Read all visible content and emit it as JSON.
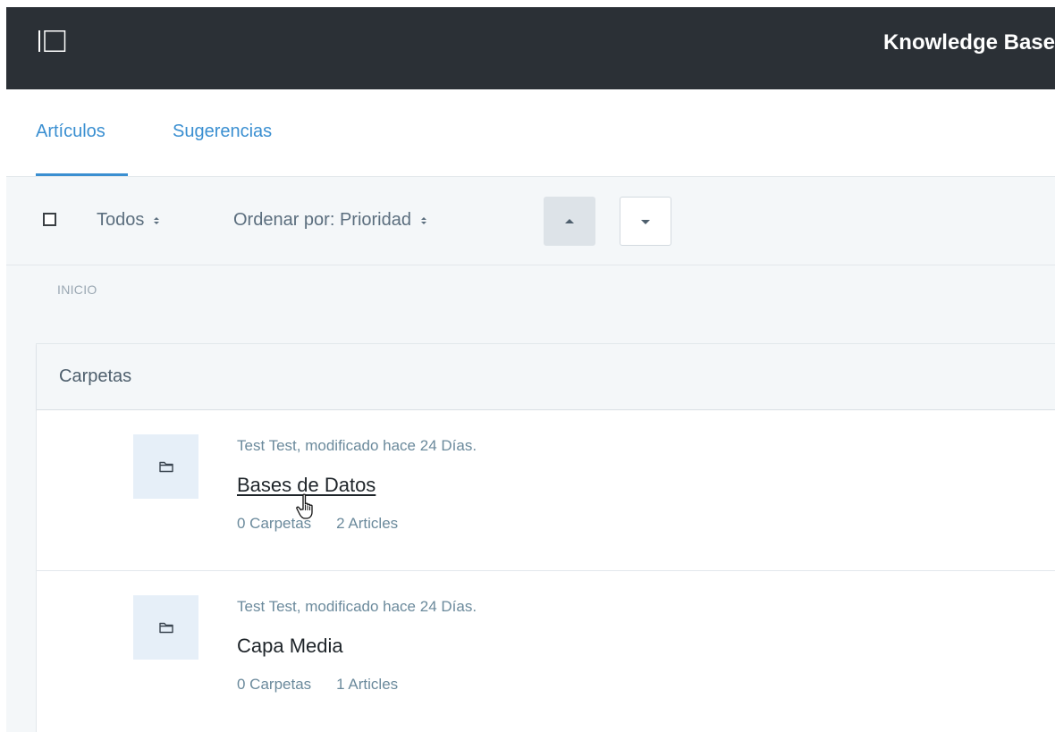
{
  "header": {
    "title": "Knowledge Base",
    "bg_color": "#2b3036"
  },
  "tabs": [
    {
      "label": "Artículos",
      "active": true
    },
    {
      "label": "Sugerencias",
      "active": false
    }
  ],
  "toolbar": {
    "filter_value": "Todos",
    "sort_value": "Ordenar por: Prioridad",
    "sort_up_active": true
  },
  "breadcrumb": "INICIO",
  "panel": {
    "title": "Carpetas",
    "folders": [
      {
        "meta": "Test Test, modificado hace 24 Días.",
        "name": "Bases de Datos",
        "folders_count": "0 Carpetas",
        "articles_count": "2 Articles"
      },
      {
        "meta": "Test Test, modificado hace 24 Días.",
        "name": "Capa Media",
        "folders_count": "0 Carpetas",
        "articles_count": "1 Articles"
      }
    ]
  },
  "colors": {
    "accent": "#3a8fd1",
    "muted_text": "#6b8a9c",
    "icon_box": "#e6eff8"
  }
}
